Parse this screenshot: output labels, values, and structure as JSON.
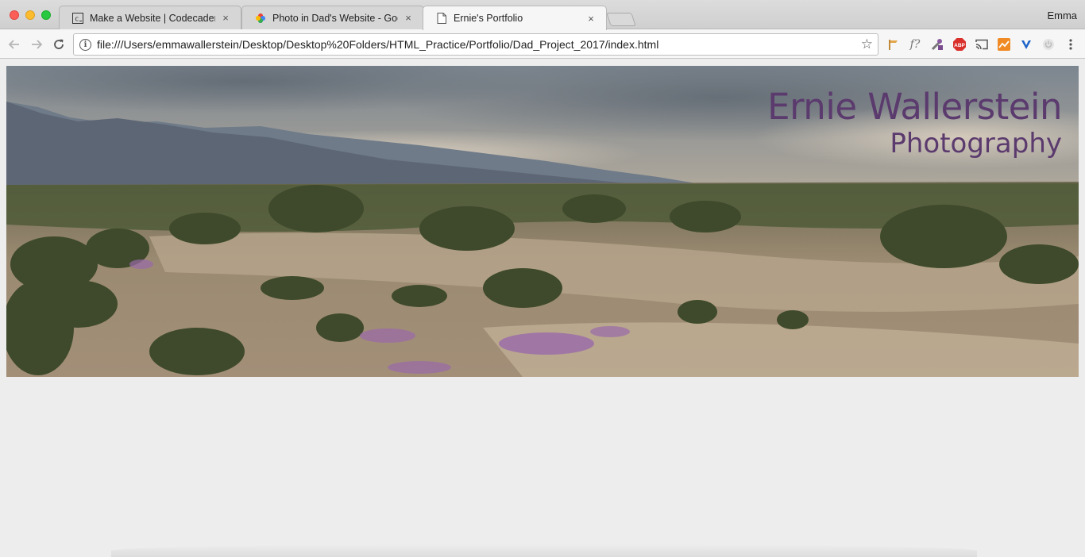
{
  "browser": {
    "tabs": [
      {
        "title": "Make a Website | Codecademy",
        "favicon": "codecademy-icon",
        "active": false
      },
      {
        "title": "Photo in Dad's Website - Goog",
        "favicon": "google-photos-icon",
        "active": false
      },
      {
        "title": "Ernie's Portfolio",
        "favicon": "document-icon",
        "active": true
      }
    ],
    "close_glyph": "×",
    "profile_name": "Emma",
    "url": "file:///Users/emmawallerstein/Desktop/Desktop%20Folders/HTML_Practice/Portfolio/Dad_Project_2017/index.html",
    "extensions": [
      "bookmark-flag-icon",
      "formula-icon",
      "eyedropper-icon",
      "adblock-icon",
      "cast-icon",
      "analytics-icon",
      "vpn-icon",
      "power-icon",
      "menu-icon"
    ]
  },
  "page": {
    "hero": {
      "title": "Ernie Wallerstein",
      "subtitle": "Photography"
    }
  },
  "colors": {
    "brand_text": "#5b3a6e",
    "page_background": "#ededed"
  }
}
